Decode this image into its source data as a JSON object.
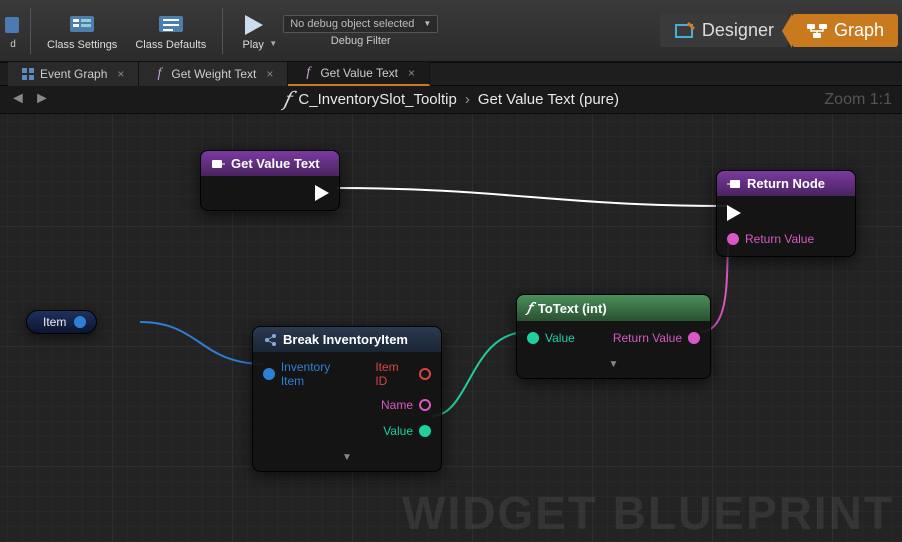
{
  "toolbar": {
    "class_settings": "Class Settings",
    "class_defaults": "Class Defaults",
    "play": "Play",
    "debug_selector": "No debug object selected",
    "debug_label": "Debug Filter"
  },
  "modes": {
    "designer": "Designer",
    "graph": "Graph"
  },
  "tabs": [
    {
      "label": "Event Graph",
      "icon": "event"
    },
    {
      "label": "Get Weight Text",
      "icon": "func"
    },
    {
      "label": "Get Value Text",
      "icon": "func",
      "active": true
    }
  ],
  "breadcrumb": {
    "class": "C_InventorySlot_Tooltip",
    "func": "Get Value Text (pure)"
  },
  "zoom": "Zoom 1:1",
  "nodes": {
    "entry": {
      "title": "Get Value Text"
    },
    "return": {
      "title": "Return Node",
      "pin": "Return Value"
    },
    "break_node": {
      "title": "Break InventoryItem",
      "in": "Inventory Item",
      "out1": "Item ID",
      "out2": "Name",
      "out3": "Value"
    },
    "totext": {
      "title": "ToText (int)",
      "in": "Value",
      "out": "Return Value"
    },
    "var_item": "Item"
  },
  "watermark": "WIDGET BLUEPRINT"
}
